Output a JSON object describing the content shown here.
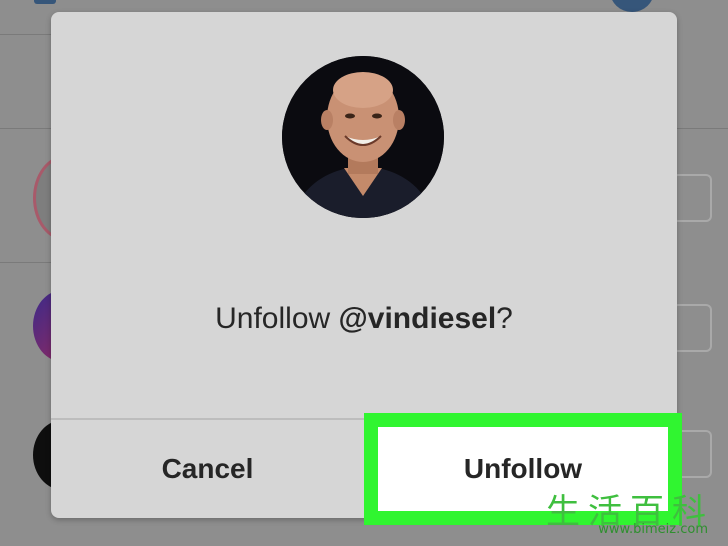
{
  "dialog": {
    "prompt_prefix": "Unfollow ",
    "username": "@vindiesel",
    "prompt_suffix": "?",
    "cancel_label": "Cancel",
    "unfollow_label": "Unfollow",
    "profile_photo": "profile-photo-icon"
  },
  "watermark": {
    "chinese": "生活百科",
    "url": "www.bimeiz.com"
  },
  "colors": {
    "highlight": "#30f530",
    "dialog_bg": "#d6d6d6",
    "overlay": "#8e8e8e"
  }
}
